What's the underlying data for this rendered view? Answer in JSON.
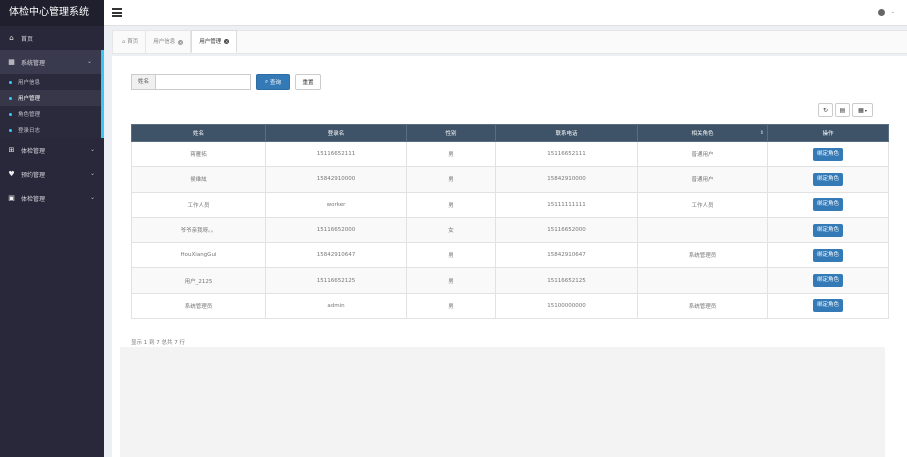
{
  "app": {
    "title": "体检中心管理系统"
  },
  "sidebar": {
    "items": [
      {
        "label": "首页",
        "icon": "home-icon"
      },
      {
        "label": "系统管理",
        "icon": "windows-icon"
      },
      {
        "label": "体检管理",
        "icon": "plus-square-icon"
      },
      {
        "label": "预约管理",
        "icon": "heartbeat-icon"
      },
      {
        "label": "体检管理",
        "icon": "calendar-check-icon"
      }
    ],
    "subitems": [
      {
        "label": "用户信息"
      },
      {
        "label": "用户管理"
      },
      {
        "label": "角色管理"
      },
      {
        "label": "登录日志"
      }
    ]
  },
  "tabs": [
    {
      "label": "首页"
    },
    {
      "label": "用户信息"
    },
    {
      "label": "用户管理"
    }
  ],
  "search": {
    "addon": "姓名",
    "value": "",
    "placeholder": "",
    "query_label": "查询",
    "reset_label": "重置"
  },
  "table": {
    "headers": [
      "姓名",
      "登录名",
      "性别",
      "联系电话",
      "相关角色",
      "操作"
    ],
    "action_label": "绑定角色",
    "rows": [
      [
        "蒋雁拓",
        "15116652111",
        "男",
        "15116652111",
        "普通用户"
      ],
      [
        "侯维絃",
        "15842910000",
        "男",
        "15842910000",
        "普通用户"
      ],
      [
        "工作人员",
        "worker",
        "男",
        "15111111111",
        "工作人员"
      ],
      [
        "爷爷亲我呀。。",
        "15116652000",
        "女",
        "15116652000",
        ""
      ],
      [
        "HouXiangGui",
        "15842910647",
        "男",
        "15842910647",
        "系统管理员"
      ],
      [
        "用户_2125",
        "15116652125",
        "男",
        "15116652125",
        ""
      ],
      [
        "系统管理员",
        "admin",
        "男",
        "15100000000",
        "系统管理员"
      ]
    ]
  },
  "pagination": {
    "info": "显示 1 到 7 总共 7 行"
  },
  "colors": {
    "sidebar": "#28283a",
    "accent": "#3ec5f5",
    "primary": "#337ab7",
    "table_header": "#3e5368"
  }
}
